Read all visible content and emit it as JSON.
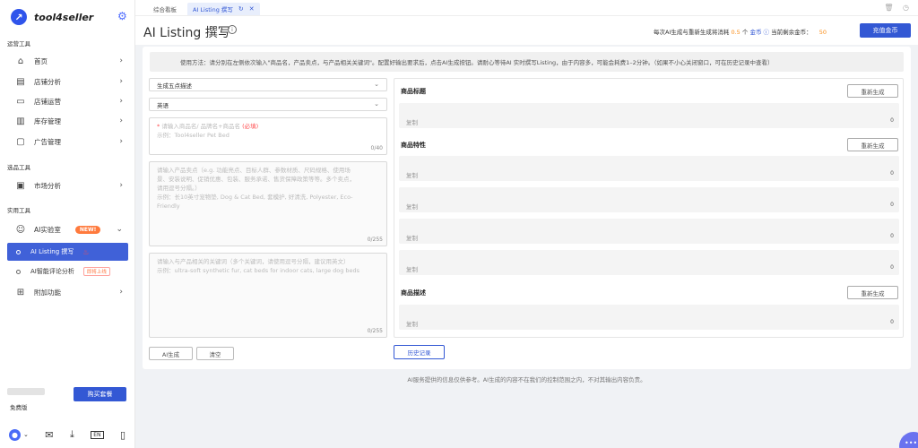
{
  "brand": {
    "name": "tool4seller",
    "logo_glyph": "↗"
  },
  "sidebar": {
    "sections": [
      {
        "title": "运营工具"
      },
      {
        "title": "选品工具"
      },
      {
        "title": "实用工具"
      }
    ],
    "items": [
      {
        "label": "首页",
        "icon": "home-icon",
        "glyph": "⌂"
      },
      {
        "label": "店铺分析",
        "icon": "chart-icon",
        "glyph": "▤"
      },
      {
        "label": "店铺运营",
        "icon": "store-icon",
        "glyph": "▭"
      },
      {
        "label": "库存管理",
        "icon": "inventory-icon",
        "glyph": "▥"
      },
      {
        "label": "广告管理",
        "icon": "monitor-icon",
        "glyph": "▢"
      },
      {
        "label": "市场分析",
        "icon": "bag-icon",
        "glyph": "▣"
      },
      {
        "label": "AI实验室",
        "icon": "robot-icon",
        "glyph": "☺",
        "badge": "NEW!"
      },
      {
        "label": "附加功能",
        "icon": "grid-icon",
        "glyph": "⊞"
      }
    ],
    "sub_items": [
      {
        "label": "AI Listing 撰写",
        "active": true
      },
      {
        "label": "AI智能评论分析",
        "badge": "即将上线"
      }
    ],
    "buy_label": "购买套餐",
    "plan_label": "免费版",
    "footer_icons": [
      "user-avatar",
      "mail-icon",
      "download-icon",
      "language-icon",
      "mobile-icon"
    ]
  },
  "tabs": [
    {
      "label": "综合看板"
    },
    {
      "label": "AI Listing 撰写",
      "active": true
    }
  ],
  "header": {
    "title": "AI Listing 撰写",
    "cost_prefix": "每次AI生成与重新生成将消耗",
    "cost_value": "0.5",
    "cost_unit": "个",
    "currency": "金币",
    "balance_prefix": "当前剩余金币：",
    "balance_value": "50",
    "recharge_label": "充值金币"
  },
  "usage_tip": "使用方法：请分别在左侧依次输入\"商品名，产品卖点，与产品相关关键词\"。配置好输出要求后，点击AI生成按钮。请耐心等待AI 实时撰写Listing，由于内容多，可能会耗费1–2分钟。（如果不小心关闭窗口，可在历史记录中查看）",
  "form": {
    "mode_select": "生成五点描述",
    "language_select": "英语",
    "name_placeholder": "请输入商品名/ 品牌名+商品名",
    "name_required": "(必填)",
    "name_example": "示例：Tool4seller Pet Bed",
    "name_counter": "0/40",
    "features_placeholder_1": "请输入产品卖点（e.g. 功能亮点、目标人群、参数材质、尺码规格、使用场",
    "features_placeholder_2": "景、安装说明、促销优惠、包装、服务承诺、售货保障政策等等。多个卖点，",
    "features_placeholder_3": "请用逗号分隔。）",
    "features_example_1": "示例：长10英寸宠物垫, Dog & Cat Bed, 套模护, 好清洗, Polyester, Eco-",
    "features_example_2": "Friendly",
    "features_counter": "0/255",
    "keywords_placeholder": "请输入与产品相关的关键词（多个关键词，请使用逗号分隔，建议用英文）",
    "keywords_example": "示例：ultra-soft synthetic fur, cat beds for indoor cats, large dog beds",
    "keywords_counter": "0/255",
    "generate_label": "AI生成",
    "clear_label": "清空"
  },
  "output": {
    "title_label": "商品标题",
    "features_label": "商品特性",
    "desc_label": "商品描述",
    "regen_label": "重新生成",
    "copy_label": "复制",
    "count": "0",
    "history_label": "历史记录"
  },
  "disclaimer": "AI服务提供的信息仅供参考。AI生成的内容不在我们的控制范围之内，不对其输出内容负责。",
  "fab_label": "•••"
}
